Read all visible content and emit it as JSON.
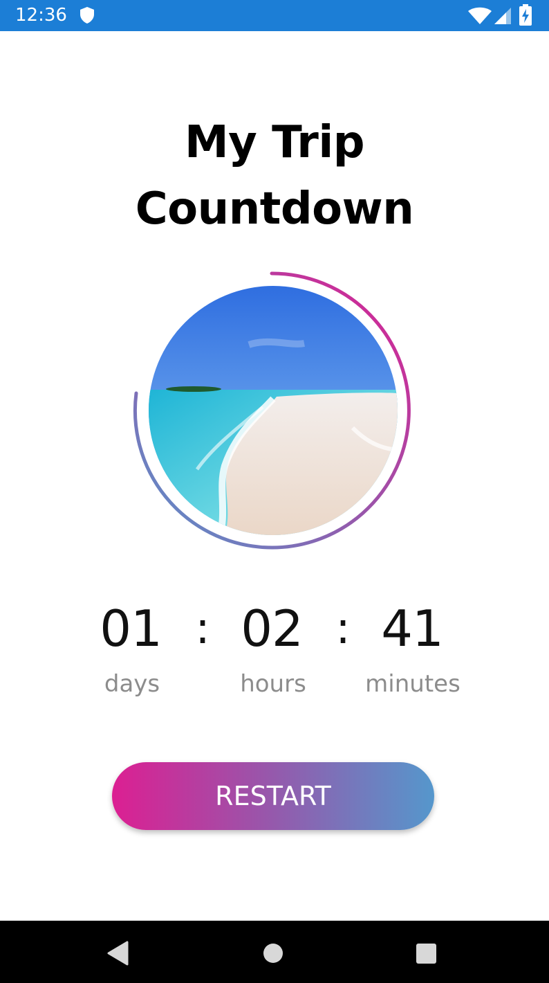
{
  "status_bar": {
    "time": "12:36",
    "background_color": "#1c7ed6",
    "icons": [
      "shield-icon",
      "wifi-icon",
      "cell-signal-icon",
      "battery-charging-icon"
    ]
  },
  "title": {
    "line1": "My Trip",
    "line2": "Countdown"
  },
  "progress_ring": {
    "gradient_colors": [
      "#dc1f92",
      "#9559ac",
      "#5597cc"
    ],
    "image_description_icon": "beach-photo"
  },
  "countdown": {
    "days_value": "01",
    "days_label": "days",
    "hours_value": "02",
    "hours_label": "hours",
    "minutes_value": "41",
    "minutes_label": "minutes",
    "separator": ":"
  },
  "restart_button": {
    "label": "RESTART",
    "gradient_colors": [
      "#dc1f92",
      "#9559ac",
      "#5597cc"
    ]
  },
  "nav_bar": {
    "icons": [
      "back-icon",
      "home-icon",
      "recents-icon"
    ]
  }
}
